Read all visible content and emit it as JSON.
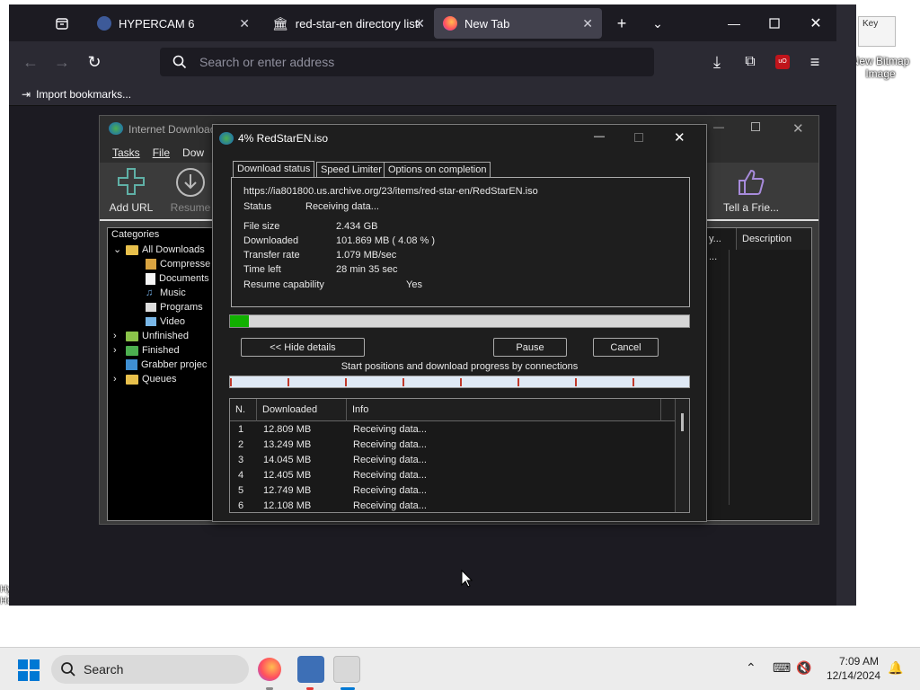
{
  "desktop": {
    "icon_label": "New Bitmap Image",
    "icon_caption": "Key",
    "left_label": "Hype Home"
  },
  "browser": {
    "tabs": [
      {
        "label": "HYPERCAM 6",
        "icon": "hypercam-icon"
      },
      {
        "label": "red-star-en directory listi",
        "icon": "archive-icon"
      },
      {
        "label": "New Tab",
        "icon": "firefox-icon",
        "active": true
      }
    ],
    "url_placeholder": "Search or enter address",
    "bookmarks_import": "Import bookmarks..."
  },
  "idm": {
    "title": "Internet Download",
    "menu": [
      "Tasks",
      "File",
      "Dow"
    ],
    "toolbar": [
      {
        "label": "Add URL",
        "icon": "plus-icon"
      },
      {
        "label": "Resume",
        "icon": "download-circle-icon"
      },
      {
        "label": "Tell a Frie...",
        "icon": "thumbs-up-icon"
      }
    ],
    "categories_header": "Categories",
    "tree": [
      {
        "label": "All Downloads",
        "level": 0,
        "expander": "v"
      },
      {
        "label": "Compresse",
        "level": 1
      },
      {
        "label": "Documents",
        "level": 1
      },
      {
        "label": "Music",
        "level": 1
      },
      {
        "label": "Programs",
        "level": 1
      },
      {
        "label": "Video",
        "level": 1
      },
      {
        "label": "Unfinished",
        "level": 0,
        "expander": ">"
      },
      {
        "label": "Finished",
        "level": 0,
        "expander": ">"
      },
      {
        "label": "Grabber projec",
        "level": 0,
        "expander": ""
      },
      {
        "label": "Queues",
        "level": 0,
        "expander": ">"
      }
    ],
    "column_partial": "y...",
    "column_description": "Description",
    "row_partial": "..."
  },
  "dialog": {
    "title": "4% RedStarEN.iso",
    "tabs": [
      "Download status",
      "Speed Limiter",
      "Options on completion"
    ],
    "url": "https://ia801800.us.archive.org/23/items/red-star-en/RedStarEN.iso",
    "status_label": "Status",
    "status_value": "Receiving data...",
    "file_size_label": "File size",
    "file_size_value": "2.434  GB",
    "downloaded_label": "Downloaded",
    "downloaded_value": "101.869  MB  ( 4.08 % )",
    "transfer_label": "Transfer rate",
    "transfer_value": "1.079  MB/sec",
    "time_left_label": "Time left",
    "time_left_value": "28 min 35 sec",
    "resume_label": "Resume capability",
    "resume_value": "Yes",
    "progress_percent": 4.08,
    "hide_details": "<< Hide details",
    "pause": "Pause",
    "cancel": "Cancel",
    "connections_caption": "Start positions and download progress by connections",
    "connections_header": {
      "n": "N.",
      "downloaded": "Downloaded",
      "info": "Info"
    },
    "connections": [
      {
        "n": "1",
        "downloaded": "12.809  MB",
        "info": "Receiving data..."
      },
      {
        "n": "2",
        "downloaded": "13.249  MB",
        "info": "Receiving data..."
      },
      {
        "n": "3",
        "downloaded": "14.045  MB",
        "info": "Receiving data..."
      },
      {
        "n": "4",
        "downloaded": "12.405  MB",
        "info": "Receiving data..."
      },
      {
        "n": "5",
        "downloaded": "12.749  MB",
        "info": "Receiving data..."
      },
      {
        "n": "6",
        "downloaded": "12.108  MB",
        "info": "Receiving data..."
      }
    ]
  },
  "taskbar": {
    "search": "Search",
    "time": "7:09 AM",
    "date": "12/14/2024"
  },
  "colors": {
    "browser_bg": "#1c1b22",
    "progress_green": "#11b000",
    "taskbar_bg": "#ececec"
  }
}
